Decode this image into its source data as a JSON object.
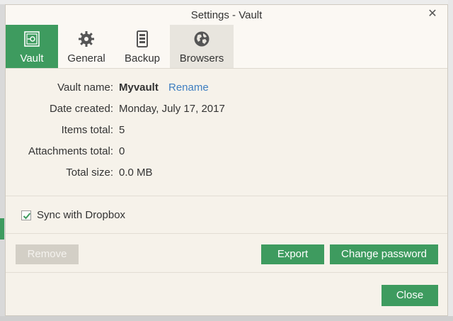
{
  "window": {
    "title": "Settings - Vault",
    "close_glyph": "✕"
  },
  "tabs": [
    {
      "label": "Vault",
      "icon": "vault-icon",
      "active": true
    },
    {
      "label": "General",
      "icon": "gear-icon",
      "active": false
    },
    {
      "label": "Backup",
      "icon": "backup-icon",
      "active": false
    },
    {
      "label": "Browsers",
      "icon": "globe-icon",
      "active": false
    }
  ],
  "vault_info": {
    "name_label": "Vault name:",
    "name_value": "Myvault",
    "rename_link": "Rename",
    "date_label": "Date created:",
    "date_value": "Monday, July 17, 2017",
    "items_label": "Items total:",
    "items_value": "5",
    "attachments_label": "Attachments total:",
    "attachments_value": "0",
    "size_label": "Total size:",
    "size_value": "0.0 MB"
  },
  "sync": {
    "label": "Sync with Dropbox",
    "checked": true
  },
  "buttons": {
    "remove": "Remove",
    "export": "Export",
    "change_password": "Change password",
    "close": "Close"
  },
  "colors": {
    "accent": "#3e9b5f",
    "link": "#3f7fc1",
    "disabled": "#d3cfc6",
    "dialog_bg": "#f6f2ea"
  }
}
